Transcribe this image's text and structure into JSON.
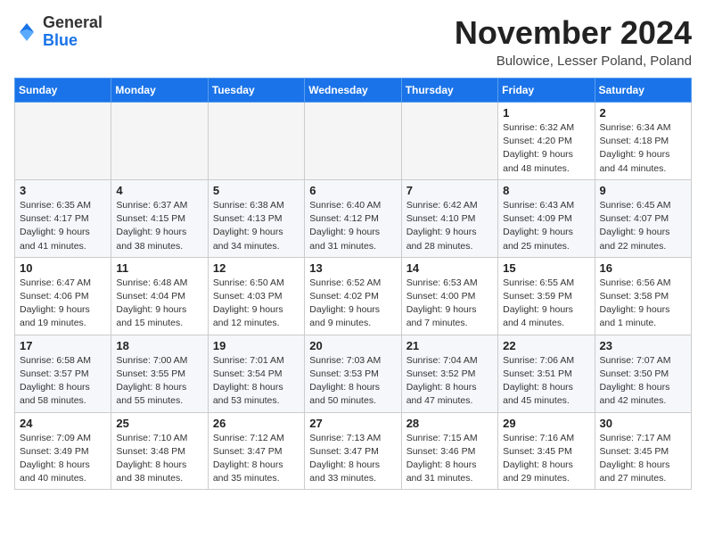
{
  "header": {
    "logo_general": "General",
    "logo_blue": "Blue",
    "month_title": "November 2024",
    "subtitle": "Bulowice, Lesser Poland, Poland"
  },
  "days_of_week": [
    "Sunday",
    "Monday",
    "Tuesday",
    "Wednesday",
    "Thursday",
    "Friday",
    "Saturday"
  ],
  "weeks": [
    {
      "alt": false,
      "days": [
        {
          "num": "",
          "info": "",
          "empty": true
        },
        {
          "num": "",
          "info": "",
          "empty": true
        },
        {
          "num": "",
          "info": "",
          "empty": true
        },
        {
          "num": "",
          "info": "",
          "empty": true
        },
        {
          "num": "",
          "info": "",
          "empty": true
        },
        {
          "num": "1",
          "info": "Sunrise: 6:32 AM\nSunset: 4:20 PM\nDaylight: 9 hours\nand 48 minutes."
        },
        {
          "num": "2",
          "info": "Sunrise: 6:34 AM\nSunset: 4:18 PM\nDaylight: 9 hours\nand 44 minutes."
        }
      ]
    },
    {
      "alt": true,
      "days": [
        {
          "num": "3",
          "info": "Sunrise: 6:35 AM\nSunset: 4:17 PM\nDaylight: 9 hours\nand 41 minutes."
        },
        {
          "num": "4",
          "info": "Sunrise: 6:37 AM\nSunset: 4:15 PM\nDaylight: 9 hours\nand 38 minutes."
        },
        {
          "num": "5",
          "info": "Sunrise: 6:38 AM\nSunset: 4:13 PM\nDaylight: 9 hours\nand 34 minutes."
        },
        {
          "num": "6",
          "info": "Sunrise: 6:40 AM\nSunset: 4:12 PM\nDaylight: 9 hours\nand 31 minutes."
        },
        {
          "num": "7",
          "info": "Sunrise: 6:42 AM\nSunset: 4:10 PM\nDaylight: 9 hours\nand 28 minutes."
        },
        {
          "num": "8",
          "info": "Sunrise: 6:43 AM\nSunset: 4:09 PM\nDaylight: 9 hours\nand 25 minutes."
        },
        {
          "num": "9",
          "info": "Sunrise: 6:45 AM\nSunset: 4:07 PM\nDaylight: 9 hours\nand 22 minutes."
        }
      ]
    },
    {
      "alt": false,
      "days": [
        {
          "num": "10",
          "info": "Sunrise: 6:47 AM\nSunset: 4:06 PM\nDaylight: 9 hours\nand 19 minutes."
        },
        {
          "num": "11",
          "info": "Sunrise: 6:48 AM\nSunset: 4:04 PM\nDaylight: 9 hours\nand 15 minutes."
        },
        {
          "num": "12",
          "info": "Sunrise: 6:50 AM\nSunset: 4:03 PM\nDaylight: 9 hours\nand 12 minutes."
        },
        {
          "num": "13",
          "info": "Sunrise: 6:52 AM\nSunset: 4:02 PM\nDaylight: 9 hours\nand 9 minutes."
        },
        {
          "num": "14",
          "info": "Sunrise: 6:53 AM\nSunset: 4:00 PM\nDaylight: 9 hours\nand 7 minutes."
        },
        {
          "num": "15",
          "info": "Sunrise: 6:55 AM\nSunset: 3:59 PM\nDaylight: 9 hours\nand 4 minutes."
        },
        {
          "num": "16",
          "info": "Sunrise: 6:56 AM\nSunset: 3:58 PM\nDaylight: 9 hours\nand 1 minute."
        }
      ]
    },
    {
      "alt": true,
      "days": [
        {
          "num": "17",
          "info": "Sunrise: 6:58 AM\nSunset: 3:57 PM\nDaylight: 8 hours\nand 58 minutes."
        },
        {
          "num": "18",
          "info": "Sunrise: 7:00 AM\nSunset: 3:55 PM\nDaylight: 8 hours\nand 55 minutes."
        },
        {
          "num": "19",
          "info": "Sunrise: 7:01 AM\nSunset: 3:54 PM\nDaylight: 8 hours\nand 53 minutes."
        },
        {
          "num": "20",
          "info": "Sunrise: 7:03 AM\nSunset: 3:53 PM\nDaylight: 8 hours\nand 50 minutes."
        },
        {
          "num": "21",
          "info": "Sunrise: 7:04 AM\nSunset: 3:52 PM\nDaylight: 8 hours\nand 47 minutes."
        },
        {
          "num": "22",
          "info": "Sunrise: 7:06 AM\nSunset: 3:51 PM\nDaylight: 8 hours\nand 45 minutes."
        },
        {
          "num": "23",
          "info": "Sunrise: 7:07 AM\nSunset: 3:50 PM\nDaylight: 8 hours\nand 42 minutes."
        }
      ]
    },
    {
      "alt": false,
      "days": [
        {
          "num": "24",
          "info": "Sunrise: 7:09 AM\nSunset: 3:49 PM\nDaylight: 8 hours\nand 40 minutes."
        },
        {
          "num": "25",
          "info": "Sunrise: 7:10 AM\nSunset: 3:48 PM\nDaylight: 8 hours\nand 38 minutes."
        },
        {
          "num": "26",
          "info": "Sunrise: 7:12 AM\nSunset: 3:47 PM\nDaylight: 8 hours\nand 35 minutes."
        },
        {
          "num": "27",
          "info": "Sunrise: 7:13 AM\nSunset: 3:47 PM\nDaylight: 8 hours\nand 33 minutes."
        },
        {
          "num": "28",
          "info": "Sunrise: 7:15 AM\nSunset: 3:46 PM\nDaylight: 8 hours\nand 31 minutes."
        },
        {
          "num": "29",
          "info": "Sunrise: 7:16 AM\nSunset: 3:45 PM\nDaylight: 8 hours\nand 29 minutes."
        },
        {
          "num": "30",
          "info": "Sunrise: 7:17 AM\nSunset: 3:45 PM\nDaylight: 8 hours\nand 27 minutes."
        }
      ]
    }
  ]
}
